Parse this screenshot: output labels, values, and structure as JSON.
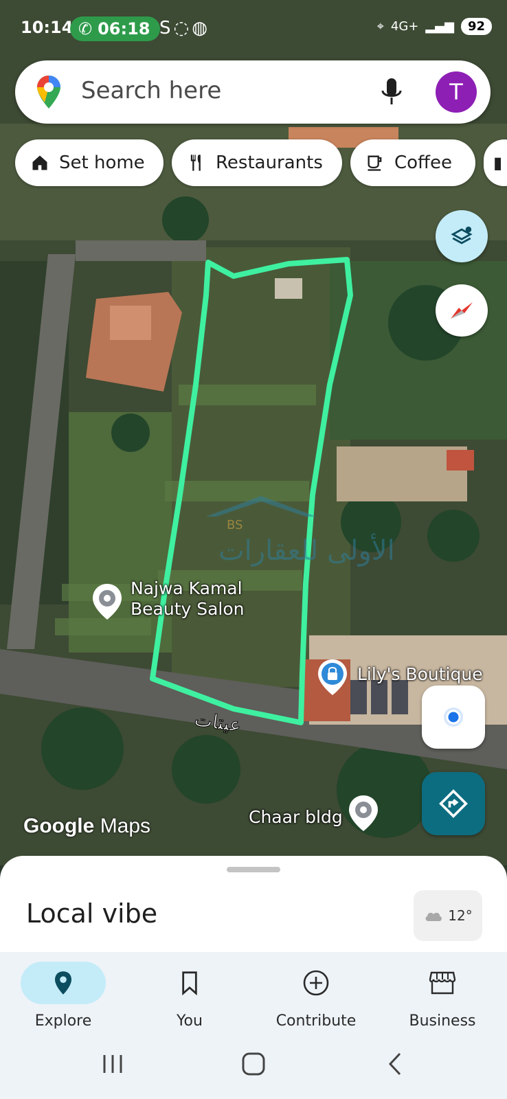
{
  "status_bar": {
    "time": "10:14",
    "call_timer": "06:18",
    "network": "4G+",
    "battery": "92"
  },
  "search": {
    "placeholder": "Search here",
    "avatar_letter": "T"
  },
  "chips": [
    {
      "label": "Set home",
      "icon": "home-icon"
    },
    {
      "label": "Restaurants",
      "icon": "restaurant-icon"
    },
    {
      "label": "Coffee",
      "icon": "coffee-icon"
    }
  ],
  "map": {
    "places": [
      {
        "name": "Najwa Kamal\nBeauty Salon",
        "line1": "Najwa Kamal",
        "line2": "Beauty Salon"
      },
      {
        "name": "Lily's Boutique"
      },
      {
        "name": "Chaar bldg"
      }
    ],
    "road_label": "عيتات",
    "watermark_text": "الأولى للعقارات",
    "logo_google": "Google",
    "logo_maps": "Maps"
  },
  "sheet": {
    "title": "Local vibe",
    "temperature": "12°"
  },
  "bottom_nav": [
    {
      "label": "Explore",
      "active": true
    },
    {
      "label": "You",
      "active": false
    },
    {
      "label": "Contribute",
      "active": false
    },
    {
      "label": "Business",
      "active": false
    }
  ],
  "colors": {
    "accent_green": "#3ef0a0",
    "explore_bg": "#c4ecf8",
    "directions_bg": "#0d6d80",
    "avatar": "#8e1fb5"
  }
}
